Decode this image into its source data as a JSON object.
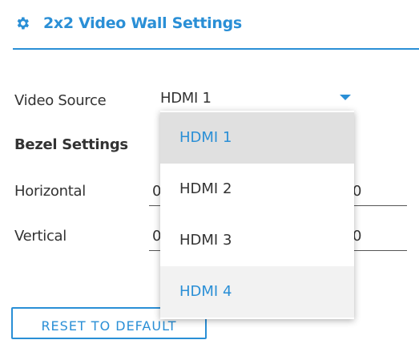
{
  "header": {
    "title": "2x2 Video Wall Settings",
    "icon": "gear-icon"
  },
  "video_source": {
    "label": "Video Source",
    "selected": "HDMI 1"
  },
  "bezel": {
    "heading": "Bezel Settings",
    "horizontal": {
      "label": "Horizontal",
      "left_value": "0",
      "right_value": "0"
    },
    "vertical": {
      "label": "Vertical",
      "left_value": "0",
      "right_value": "0"
    }
  },
  "reset_button": {
    "label": "RESET TO DEFAULT"
  },
  "dropdown": {
    "options": [
      "HDMI 1",
      "HDMI 2",
      "HDMI 3",
      "HDMI 4"
    ],
    "selected_index": 0,
    "hover_index": 3
  },
  "colors": {
    "accent": "#2a8fd6",
    "text": "#333333",
    "selected_bg": "#e0e0e0"
  }
}
